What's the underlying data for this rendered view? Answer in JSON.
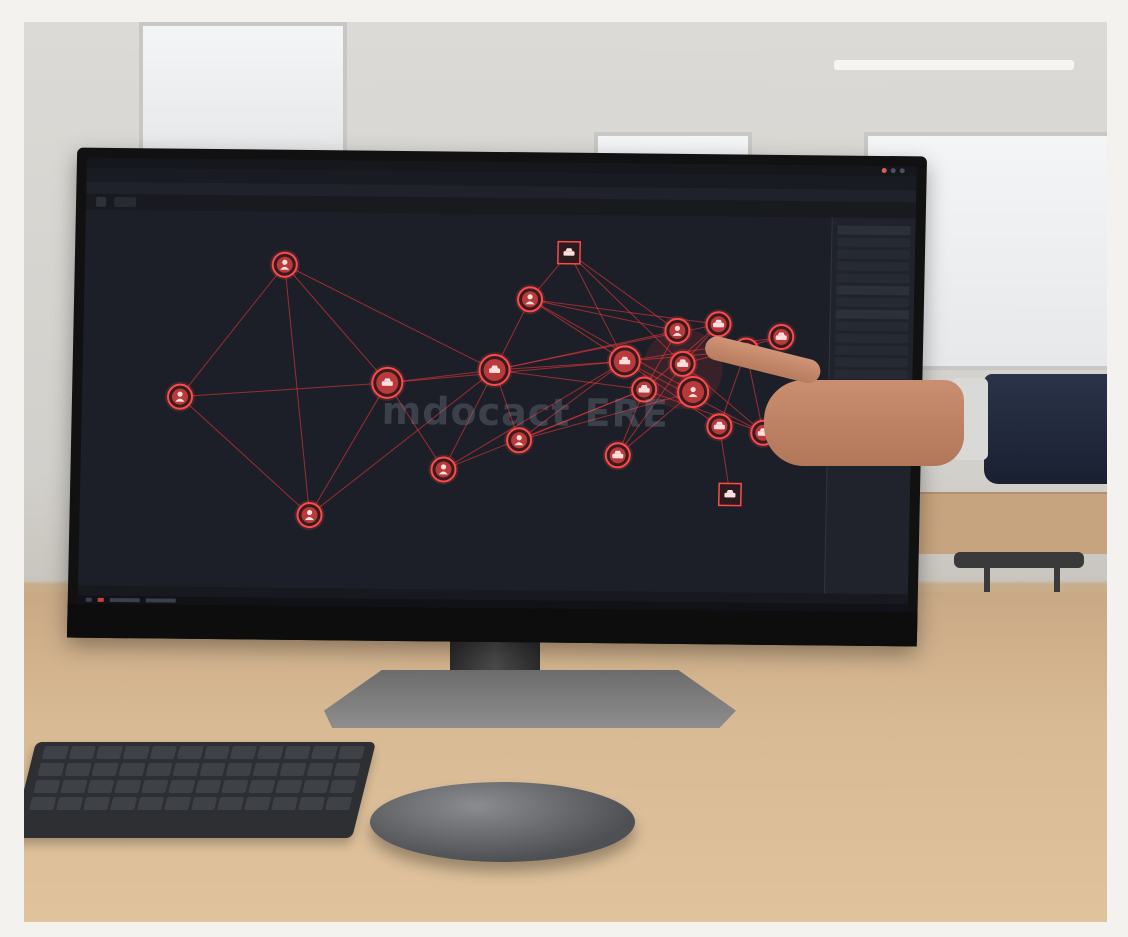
{
  "scene": {
    "description_free": true,
    "colors": {
      "screen_bg": "#1c1f28",
      "node_red": "#ff4a4a",
      "edge_red": "#ff3b3b"
    }
  },
  "app": {
    "watermark": "mdocact ERE",
    "menu": [
      "",
      "",
      "",
      "",
      "",
      "",
      "",
      ""
    ],
    "tabs": [
      "",
      "",
      "",
      "",
      "",
      ""
    ]
  },
  "graph": {
    "nodes": [
      {
        "id": "n1",
        "type": "person"
      },
      {
        "id": "n2",
        "type": "person"
      },
      {
        "id": "n3",
        "type": "person"
      },
      {
        "id": "n4",
        "type": "car"
      },
      {
        "id": "n5",
        "type": "car"
      },
      {
        "id": "n6",
        "type": "person"
      },
      {
        "id": "n7",
        "type": "person"
      },
      {
        "id": "n8",
        "type": "person"
      },
      {
        "id": "n9",
        "type": "car"
      },
      {
        "id": "n10",
        "type": "car"
      },
      {
        "id": "n11",
        "type": "person"
      },
      {
        "id": "n12",
        "type": "car"
      },
      {
        "id": "n13",
        "type": "car"
      },
      {
        "id": "n14",
        "type": "car"
      },
      {
        "id": "n15",
        "type": "person"
      },
      {
        "id": "n16",
        "type": "car"
      },
      {
        "id": "n17",
        "type": "car"
      },
      {
        "id": "n18",
        "type": "car"
      },
      {
        "id": "n19",
        "type": "car"
      },
      {
        "id": "n20",
        "type": "car"
      },
      {
        "id": "n21",
        "type": "car"
      }
    ],
    "node_icons": {
      "person": "person-icon",
      "car": "car-icon"
    }
  }
}
